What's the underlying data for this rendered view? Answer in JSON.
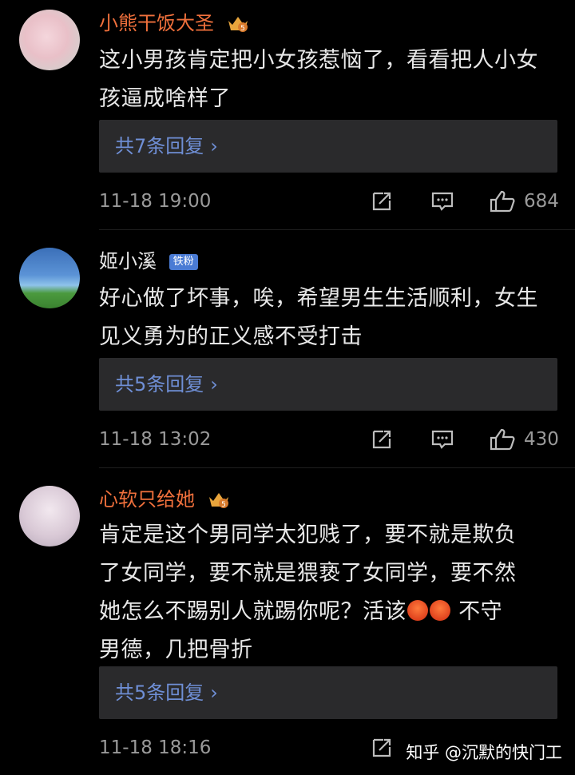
{
  "comments": [
    {
      "username": "小熊干饭大圣",
      "badge": "crown-level-5",
      "text": "这小男孩肯定把小女孩惹恼了，看看把人小女孩逼成啥样了",
      "replies_label": "共7条回复",
      "timestamp": "11-18 19:00",
      "likes": "684"
    },
    {
      "username": "姬小溪",
      "badge_text": "铁粉",
      "text": "好心做了坏事，唉，希望男生生活顺利，女生见义勇为的正义感不受打击",
      "replies_label": "共5条回复",
      "timestamp": "11-18 13:02",
      "likes": "430"
    },
    {
      "username": "心软只给她",
      "badge": "crown-level-5",
      "text_line1": "肯定是这个男同学太犯贱了，要不就是欺负",
      "text_line2": "了女同学，要不就是猥亵了女同学，要不然",
      "text_line3a": "她怎么不踢别人就踢你呢？活该",
      "text_line3b": " 不守",
      "text_line4": "男德，几把骨折",
      "emoji": "angry-face-emoji",
      "replies_label": "共5条回复",
      "timestamp": "11-18 18:16"
    }
  ],
  "watermark": "知乎 @沉默的快门工",
  "colors": {
    "background": "#000000",
    "username_vip": "#f0703c",
    "reply_link": "#6f8fd6",
    "reply_box": "#2a2a2c",
    "meta_gray": "#9a9a9a",
    "fan_badge": "#4a7bd4"
  }
}
